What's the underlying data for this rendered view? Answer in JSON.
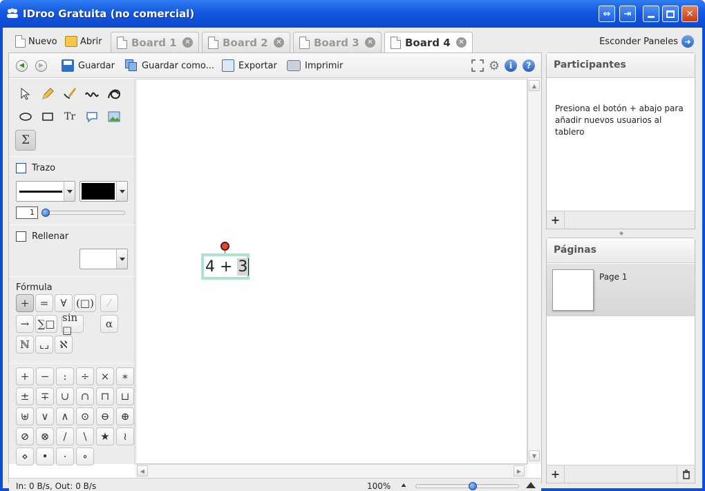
{
  "window": {
    "title": "IDroo Gratuita (no comercial)"
  },
  "tabbar": {
    "new_label": "Nuevo",
    "open_label": "Abrir",
    "tabs": [
      {
        "label": "Board 1",
        "active": false
      },
      {
        "label": "Board 2",
        "active": false
      },
      {
        "label": "Board 3",
        "active": false
      },
      {
        "label": "Board 4",
        "active": true
      }
    ],
    "hide_panels_label": "Esconder Paneles"
  },
  "toolbar": {
    "save_label": "Guardar",
    "save_as_label": "Guardar como...",
    "export_label": "Exportar",
    "print_label": "Imprimir"
  },
  "tools": {
    "stroke_label": "Trazo",
    "stroke_width": "1",
    "stroke_color": "#000000",
    "fill_label": "Rellenar",
    "fill_color": "#ffffff",
    "formula_label": "Fórmula",
    "text_tool_glyph": "Tr",
    "formula_tool_glyph": "Σ",
    "formula_categories": [
      "+",
      "=",
      "∀",
      "(□)",
      "⁄",
      "→",
      "∑□",
      "sin □",
      "α",
      "ℕ",
      "⌞⌟",
      "ℵ"
    ],
    "operators": [
      "+",
      "−",
      ":",
      "÷",
      "×",
      "∗",
      "±",
      "∓",
      "∪",
      "∩",
      "⊓",
      "⊔",
      "⊎",
      "∨",
      "∧",
      "⊙",
      "⊖",
      "⊕",
      "⊘",
      "⊗",
      "/",
      "\\",
      "★",
      "≀",
      "⋄",
      "•",
      "·",
      "∘"
    ]
  },
  "canvas": {
    "formula_text": "4 + ",
    "formula_cursor_text": "3"
  },
  "statusbar": {
    "network": "In: 0 B/s, Out: 0 B/s",
    "zoom": "100%",
    "zoom_level": 0.55
  },
  "participants": {
    "title": "Participantes",
    "hint": "Presiona el botón + abajo para añadir nuevos usuarios al tablero"
  },
  "pages": {
    "title": "Páginas",
    "items": [
      {
        "label": "Page 1"
      }
    ]
  },
  "colors": {
    "titlebar": "#1558e0",
    "accent_blue": "#2f66c9",
    "selection": "#aee3d4",
    "handle": "#e04a2e"
  }
}
